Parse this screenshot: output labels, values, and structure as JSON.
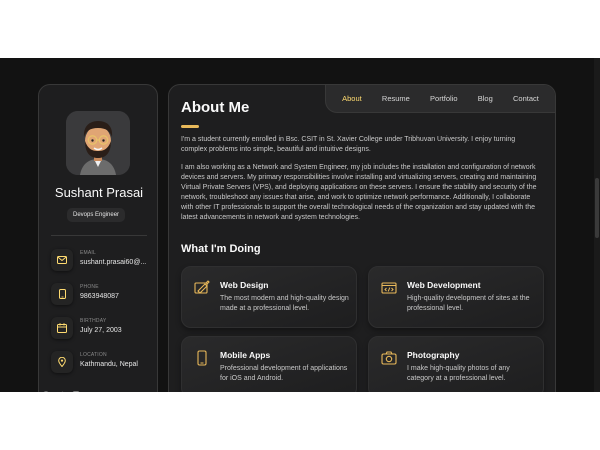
{
  "profile": {
    "name": "Sushant Prasai",
    "title": "Devops Engineer",
    "contacts": [
      {
        "label": "EMAIL",
        "value": "sushant.prasai60@...",
        "icon": "mail-icon"
      },
      {
        "label": "PHONE",
        "value": "9863948087",
        "icon": "phone-icon"
      },
      {
        "label": "BIRTHDAY",
        "value": "July 27, 2003",
        "icon": "calendar-icon"
      },
      {
        "label": "LOCATION",
        "value": "Kathmandu, Nepal",
        "icon": "location-icon"
      }
    ],
    "socials": [
      "facebook-icon",
      "twitter-icon",
      "instagram-icon"
    ]
  },
  "nav": {
    "items": [
      "About",
      "Resume",
      "Portfolio",
      "Blog",
      "Contact"
    ],
    "active": "About"
  },
  "about": {
    "heading": "About Me",
    "p1": "I'm a student currently enrolled in Bsc. CSIT in St. Xavier College under Tribhuvan University. I enjoy turning complex problems into simple, beautiful and intuitive designs.",
    "p2": "I am also working as a Network and System Engineer, my job includes the installation and configuration of network devices and servers. My primary responsibilities involve installing and virtualizing servers, creating and maintaining Virtual Private Servers (VPS), and deploying applications on these servers. I ensure the stability and security of the network, troubleshoot any issues that arise, and work to optimize network performance. Additionally, I collaborate with other IT professionals to support the overall technological needs of the organization and stay updated with the latest advancements in network and system technologies."
  },
  "doing": {
    "heading": "What I'm Doing",
    "services": [
      {
        "title": "Web Design",
        "desc": "The most modern and high-quality design made at a professional level.",
        "icon": "design-icon"
      },
      {
        "title": "Web Development",
        "desc": "High-quality development of sites at the professional level.",
        "icon": "code-icon"
      },
      {
        "title": "Mobile Apps",
        "desc": "Professional development of applications for iOS and Android.",
        "icon": "mobile-icon"
      },
      {
        "title": "Photography",
        "desc": "I make high-quality photos of any category at a professional level.",
        "icon": "camera-icon"
      }
    ]
  },
  "colors": {
    "accent": "#ffdb70",
    "background": "#121212",
    "card": "#1e1e1f"
  }
}
